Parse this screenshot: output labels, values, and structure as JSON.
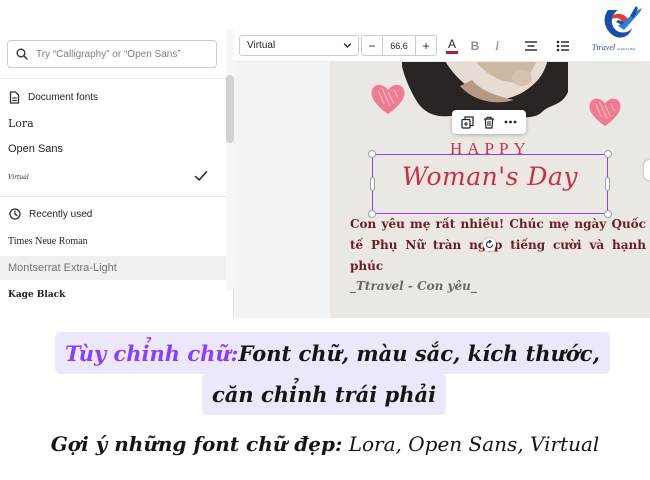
{
  "search": {
    "placeholder": "Try “Calligraphy” or “Open Sans”"
  },
  "document_fonts": {
    "header": "Document fonts",
    "items": [
      {
        "label": "Lora"
      },
      {
        "label": "Open Sans"
      },
      {
        "label": "Virtual",
        "selected": true
      }
    ]
  },
  "recently_used": {
    "header": "Recently used",
    "items": [
      {
        "label": "Times Neue Roman"
      },
      {
        "label": "Montserrat Extra-Light"
      },
      {
        "label": "Kage Black"
      }
    ]
  },
  "toolbar": {
    "font_name": "Virtual",
    "font_size": "66.6",
    "decrease_label": "−",
    "increase_label": "+",
    "color_label": "A",
    "bold_label": "B",
    "italic_label": "I",
    "text_color": "#b3183f"
  },
  "logo": {
    "text": "Ttravel",
    "sub": "an Pinche Hub"
  },
  "design": {
    "happy": "HAPPY",
    "title": "Woman's Day",
    "message": "Con yêu mẹ rất nhiều! Chúc mẹ ngày Quốc tế Phụ Nữ tràn ngập tiếng cười và hạnh phúc",
    "signature": "_Ttravel - Con yêu_",
    "accent_color": "#c8304a"
  },
  "captions": {
    "line1_highlight": "Tùy chỉnh chữ:",
    "line1_rest": " Font chữ, màu sắc, kích thước,",
    "line2": "căn chỉnh trái phải",
    "suggest_label": "Gợi ý những font chữ đẹp:",
    "suggest_fonts": " Lora, Open Sans, Virtual",
    "highlight_color": "#8a3ffc",
    "box_color": "#ece7fb"
  }
}
